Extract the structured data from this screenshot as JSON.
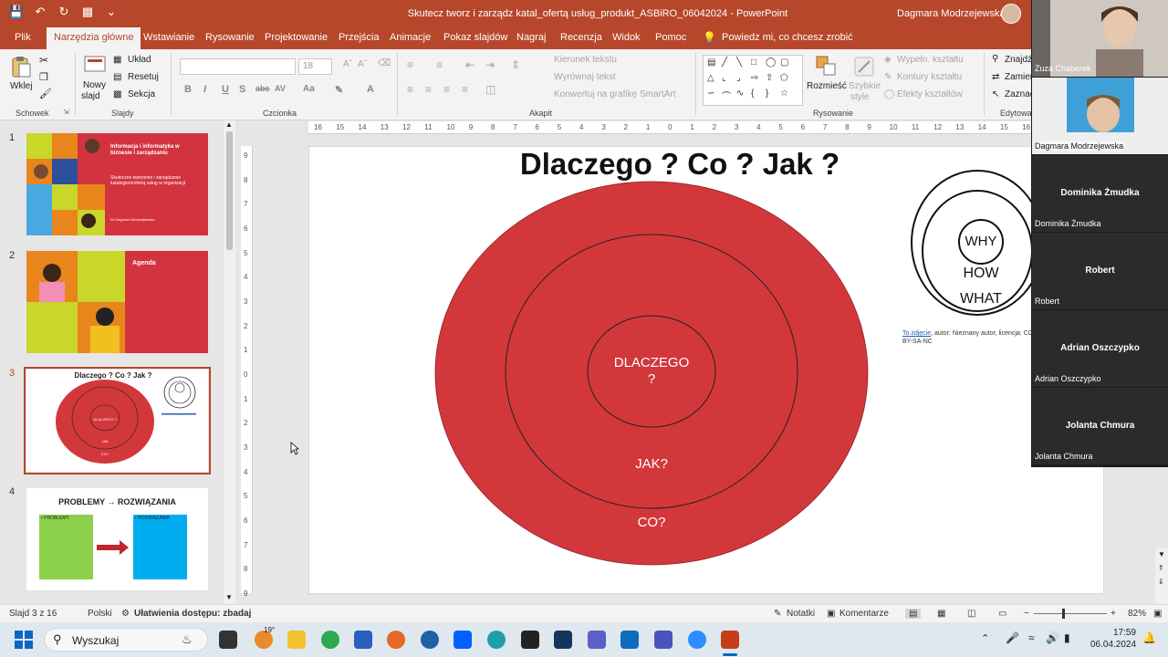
{
  "titlebar": {
    "doc_title": "Skutecz tworz i zarządz  katal_ofertą usług_produkt_ASBiRO_06042024  -  PowerPoint",
    "user_name": "Dagmara Modrzejewska"
  },
  "tabs": [
    {
      "label": "Plik"
    },
    {
      "label": "Narzędzia główne"
    },
    {
      "label": "Wstawianie"
    },
    {
      "label": "Rysowanie"
    },
    {
      "label": "Projektowanie"
    },
    {
      "label": "Przejścia"
    },
    {
      "label": "Animacje"
    },
    {
      "label": "Pokaz slajdów"
    },
    {
      "label": "Nagraj"
    },
    {
      "label": "Recenzja"
    },
    {
      "label": "Widok"
    },
    {
      "label": "Pomoc"
    }
  ],
  "tell_me": "Powiedz mi, co chcesz zrobić",
  "ribbon": {
    "paste": "Wklej",
    "new_slide_1": "Nowy",
    "new_slide_2": "slajd",
    "layout": "Układ",
    "reset": "Resetuj",
    "section": "Sekcja",
    "font_size": "18",
    "text_direction": "Kierunek tekstu",
    "align_text": "Wyrównaj tekst",
    "smartart": "Konwertuj na grafikę SmartArt",
    "arrange": "Rozmieść",
    "quick_styles_1": "Szybkie",
    "quick_styles_2": "style",
    "shape_fill": "Wypełn. kształtu",
    "shape_outline": "Kontury kształtu",
    "shape_effects": "Efekty kształtów",
    "find": "Znajdź",
    "replace": "Zamień",
    "select": "Zaznacz",
    "groups": {
      "clipboard": "Schowek",
      "slides": "Slajdy",
      "font": "Czcionka",
      "paragraph": "Akapit",
      "drawing": "Rysowanie",
      "editing": "Edytowanie"
    }
  },
  "thumbnails": [
    {
      "num": "1",
      "title": "Informacja i informatyka w biznesie i zarządzaniu",
      "subtitle": "Skuteczne tworzenie i zarządzanie katalogiem/ofertą usług w organizacji",
      "author": "Dr Dagmara Modrzejewska"
    },
    {
      "num": "2",
      "title": "Agenda"
    },
    {
      "num": "3",
      "title": "Dlaczego ? Co ? Jak ?",
      "inner": "DLACZEGO ?",
      "mid": "JAK",
      "outer": "CO?"
    },
    {
      "num": "4",
      "title": "PROBLEMY → ROZWIĄZANIA",
      "left": "• PROBLEMY",
      "right": "• ROZWIĄZANIA"
    }
  ],
  "slide": {
    "title": "Dlaczego ? Co ? Jak ?",
    "inner_label_1": "DLACZEGO",
    "inner_label_2": "?",
    "middle_label": "JAK?",
    "outer_label": "CO?",
    "logo_why": "WHY",
    "logo_how": "HOW",
    "logo_what": "WHAT",
    "credit_link": "To zdjęcie",
    "credit_text": ", autor: Nieznany autor, licencja: CC BY-SA-NC",
    "red": "#d2373c"
  },
  "ruler_h": [
    "16",
    "15",
    "14",
    "13",
    "12",
    "11",
    "10",
    "9",
    "8",
    "7",
    "6",
    "5",
    "4",
    "3",
    "2",
    "1",
    "0",
    "1",
    "2",
    "3",
    "4",
    "5",
    "6",
    "7",
    "8",
    "9",
    "10",
    "11",
    "12",
    "13",
    "14",
    "15",
    "16"
  ],
  "ruler_v": [
    "9",
    "8",
    "7",
    "6",
    "5",
    "4",
    "3",
    "2",
    "1",
    "0",
    "1",
    "2",
    "3",
    "4",
    "5",
    "6",
    "7",
    "8",
    "9"
  ],
  "call": [
    {
      "name": "Zuza Chaberek",
      "video": true
    },
    {
      "name": "Dagmara Modrzejewska",
      "video": true
    },
    {
      "name": "Dominika Żmudka"
    },
    {
      "name": "Robert"
    },
    {
      "name": "Adrian Oszczypko"
    },
    {
      "name": "Jolanta Chmura"
    }
  ],
  "status": {
    "slide_of": "Slajd 3 z 16",
    "language": "Polski",
    "accessibility": "Ułatwienia dostępu: zbadaj",
    "notes": "Notatki",
    "comments": "Komentarze",
    "zoom": "82%"
  },
  "taskbar": {
    "search_placeholder": "Wyszukaj",
    "weather": "19°",
    "time": "17:59",
    "date": "06.04.2024"
  }
}
